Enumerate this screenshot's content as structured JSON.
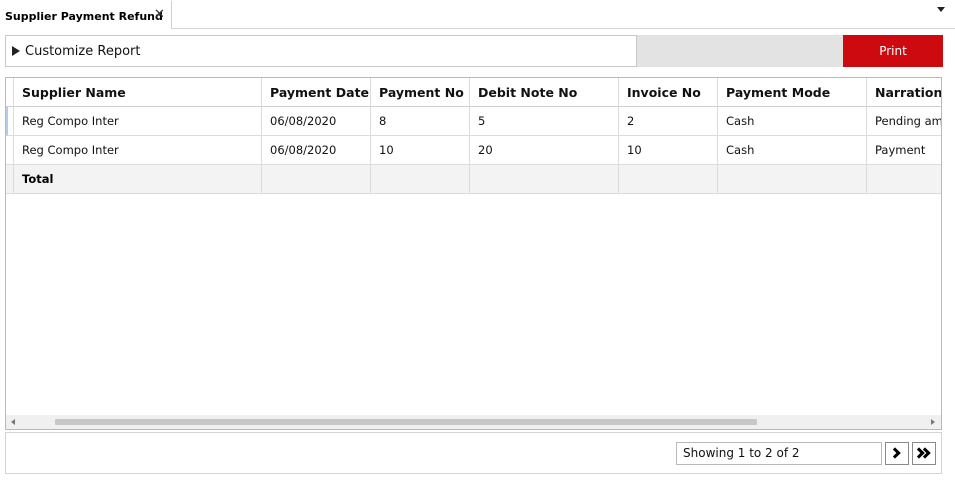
{
  "tab": {
    "title": "Supplier Payment Refund",
    "close_glyph": "✕"
  },
  "toolbar": {
    "customize_label": "Customize Report",
    "print_label": "Print",
    "accent_color": "#cc0a10"
  },
  "grid": {
    "columns": [
      "Supplier Name",
      "Payment Date",
      "Payment No",
      "Debit Note No",
      "Invoice No",
      "Payment Mode",
      "Narration"
    ],
    "rows": [
      [
        "Reg Compo Inter",
        "06/08/2020",
        "8",
        "5",
        "2",
        "Cash",
        "Pending amount"
      ],
      [
        "Reg Compo Inter",
        "06/08/2020",
        "10",
        "20",
        "10",
        "Cash",
        "Payment"
      ]
    ],
    "total_label": "Total"
  },
  "pager": {
    "status": "Showing 1 to 2 of 2",
    "next_icon": "chevron-right-icon",
    "last_icon": "double-chevron-right-icon"
  }
}
